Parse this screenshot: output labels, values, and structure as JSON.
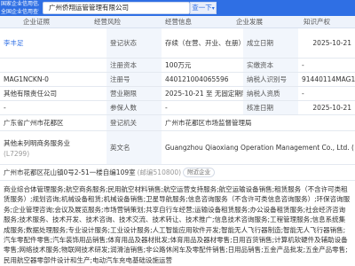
{
  "header": {
    "logo_line1": "国家企业信用信息",
    "logo_line2": "全国企业信用查询",
    "search_value": "广州侨翔运管管理有限公司",
    "search_button": "查一下",
    "chevron": "▾"
  },
  "tabs": [
    "企业证照",
    "经营风险",
    "经营信息",
    "企业发展",
    "知识产权"
  ],
  "company": {
    "legal_rep": "李丰足",
    "reg_status_label": "登记状态",
    "reg_status_value": "存续（在营、开业、在册）",
    "est_date_label": "成立日期",
    "est_date_value": "2025-10-21",
    "reg_capital_label": "注册资本",
    "reg_capital_value": "100万元",
    "paid_capital_label": "实缴资本",
    "paid_capital_value": "-",
    "credit_code_partial": "MAG1NCKN-0",
    "reg_no_label": "注册号",
    "reg_no_value": "440121004065596",
    "taxpayer_id_label": "纳税人识别号",
    "taxpayer_id_value": "91440114MAG1",
    "other_label": "其他有限责任公司",
    "op_period_label": "营业期限",
    "op_period_value": "2025-10-21 至 无固定期限",
    "taxpayer_quality_label": "纳税人资质",
    "taxpayer_quality_value": "-",
    "insured_label": "参保人数",
    "insured_value": "-",
    "approval_date_label": "核准日期",
    "approval_date_value": "2025-10-21",
    "region": "广东省广州市花都区",
    "authority_label": "登记机关",
    "authority_value": "广州市花都区市场监督管理局",
    "industry_label": "其他未列明商务服务业",
    "industry_code": "(L7299)",
    "english_label": "英文名",
    "english_value": "Guangzhou Qiaoxiang Operation Management Co., Ltd. (",
    "address": "广州市花都区花山镇0号2-51一楼自编109室",
    "postcode": "(邮编510800)",
    "address_suffix": "附近企业",
    "scope": "商业综合体管理服务;航空商务服务;民用航空材料销售;航空运营支持服务;航空运输设备销售;租赁服务（不含许可类租赁服务）;规划咨询;机械设备租赁;机械设备销售;卫星导航服务;信息咨询服务（不含许可类信息咨询服务）;环保咨询服务;企业管理咨询;会议及展览服务;市场营销策划;共享自行车经营;运输设备租赁服务;办公设备租赁服务;社会经济咨询服务;技术服务、技术开发、技术咨询、技术交流、技术转让、技术推广;信息技术咨询服务;工程管理服务;信息系统集成服务;数据处理服务;专业设计服务;工业设计服务;人工智能应用软件开发;智能无人飞行器制造;智能无人飞行器销售;汽车零配件零售;汽车装饰用品销售;体育用品及器材批发;体育用品及器材零售;日用百货销售;计算机软硬件及辅助设备零售;网络技术服务;物联网技术研发;润滑油销售;非公路休闲车及零配件销售;日用品销售;五金产品批发;五金产品零售;民用航空器零部件设计和生产;电动汽车充电基础设施运营"
  }
}
